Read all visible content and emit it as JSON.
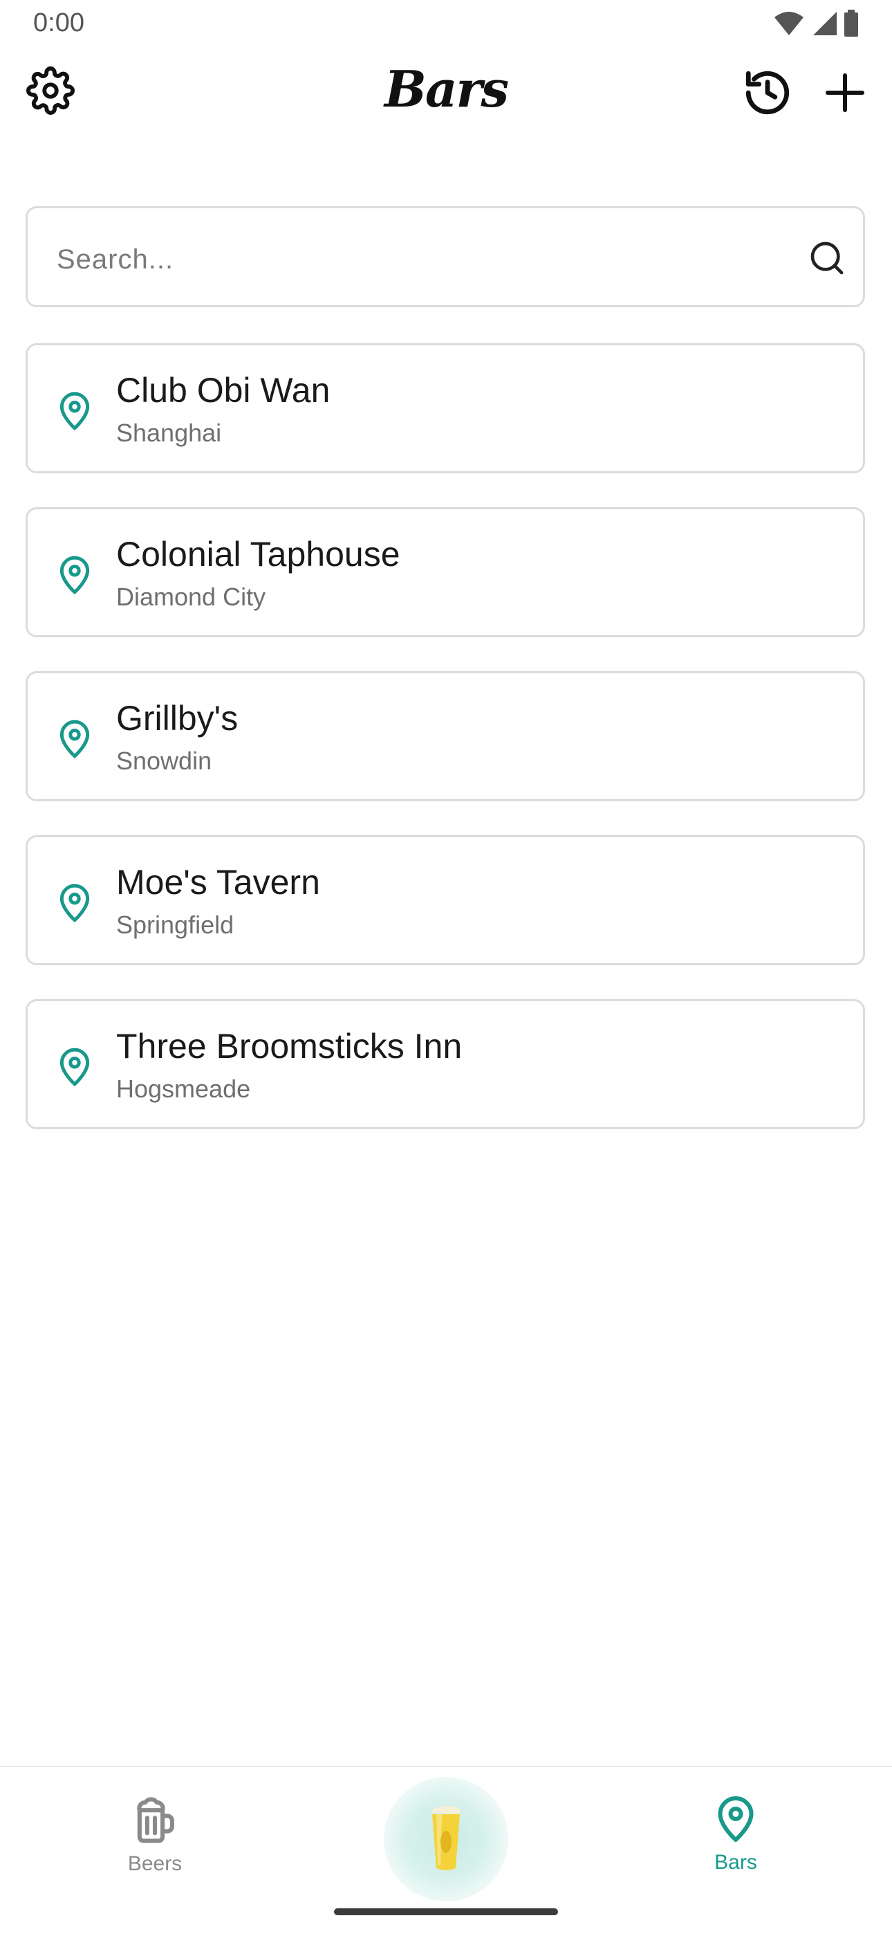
{
  "status_bar": {
    "time": "0:00"
  },
  "app_bar": {
    "title": "Bars"
  },
  "search": {
    "placeholder": "Search..."
  },
  "bars": [
    {
      "name": "Club Obi Wan",
      "city": "Shanghai"
    },
    {
      "name": "Colonial Taphouse",
      "city": "Diamond City"
    },
    {
      "name": "Grillby's",
      "city": "Snowdin"
    },
    {
      "name": "Moe's Tavern",
      "city": "Springfield"
    },
    {
      "name": "Three Broomsticks Inn",
      "city": "Hogsmeade"
    }
  ],
  "bottom_nav": {
    "beers_label": "Beers",
    "bars_label": "Bars",
    "active": "Bars"
  },
  "colors": {
    "accent": "#18998a",
    "inactive": "#8a8a8a",
    "border": "#dcdcdc"
  },
  "icons": {
    "settings": "gear-icon",
    "history": "history-icon",
    "add": "plus-icon",
    "search": "search-icon",
    "bar_item": "map-pin-icon",
    "beers_tab": "beer-mug-icon",
    "center_tab": "beer-glass-icon",
    "bars_tab": "map-pin-icon"
  }
}
